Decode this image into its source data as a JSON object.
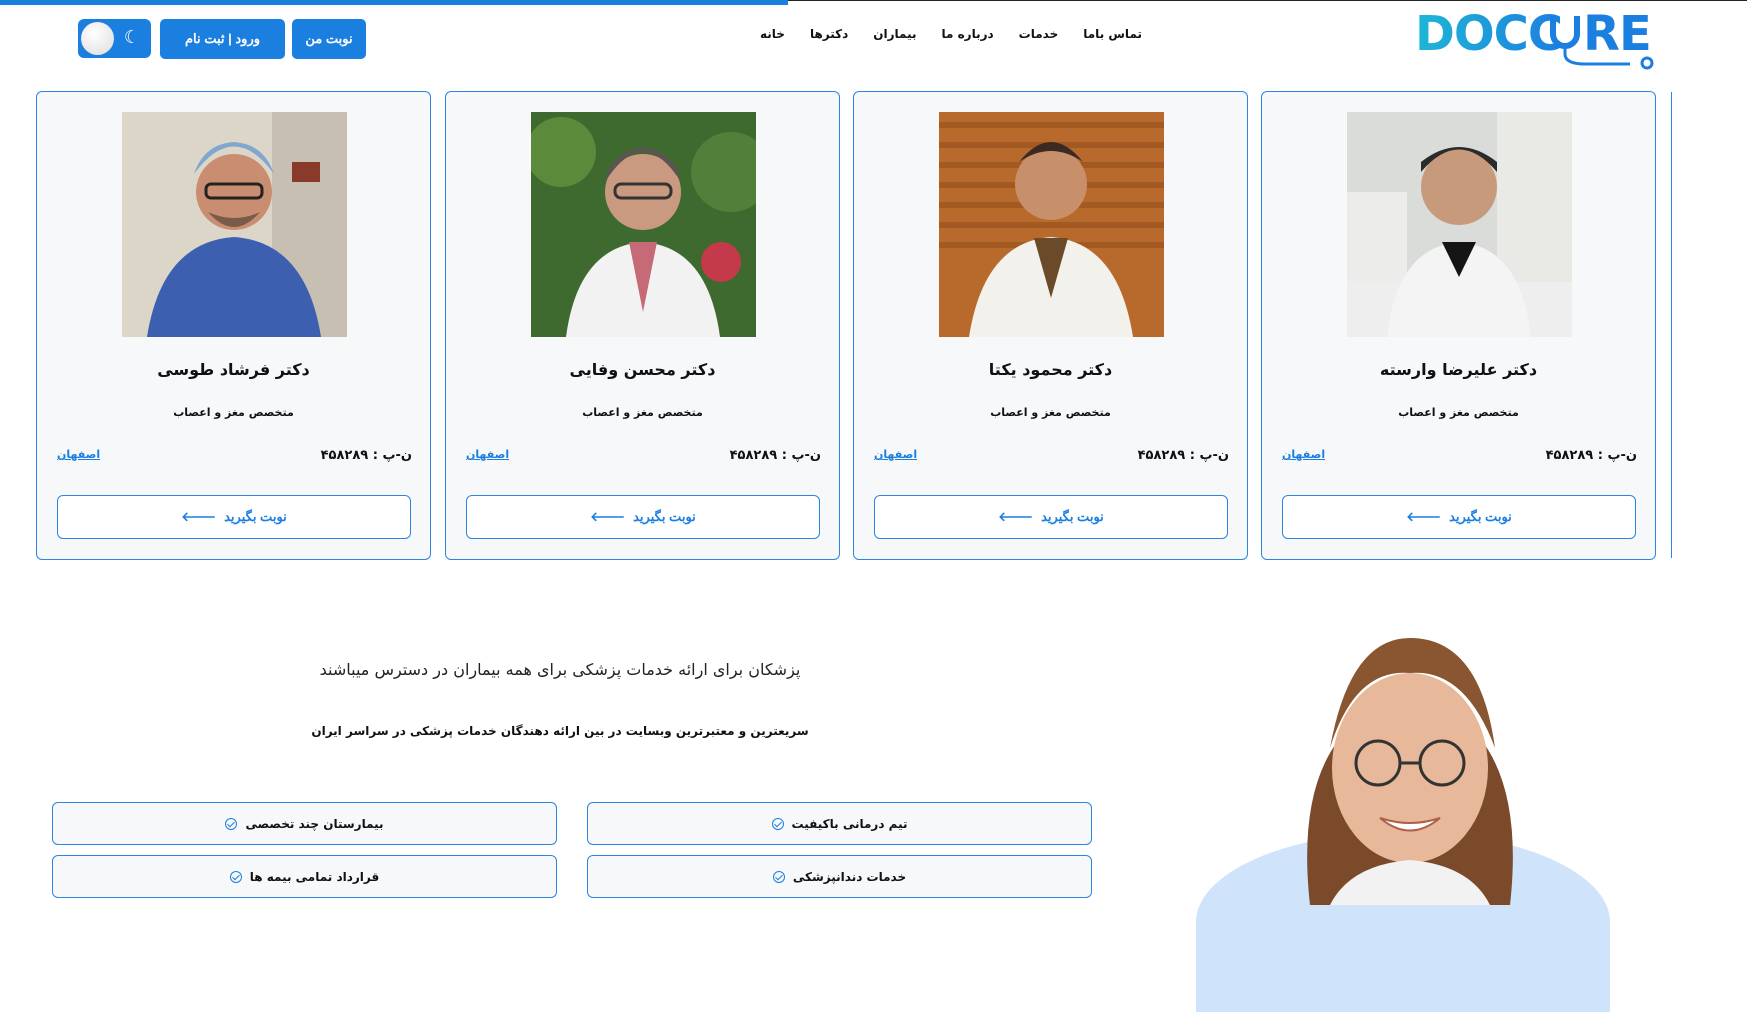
{
  "brand": {
    "name": "DOCCURE",
    "accent": "#1b7fe0"
  },
  "nav": {
    "items": [
      "خانه",
      "دکترها",
      "بیماران",
      "درباره ما",
      "خدمات",
      "تماس باما"
    ]
  },
  "header": {
    "appointment_label": "نوبت من",
    "login_label": "ورود | ثبت نام",
    "theme_toggle": "dark-mode-toggle"
  },
  "doctors": [
    {
      "name": "دکتر علیرضا وارسته",
      "specialty": "متخصص مغز و اعصاب",
      "code": "ن-پ : ۴۵۸۲۸۹",
      "city": "اصفهان",
      "book_label": "نوبت بگیرید"
    },
    {
      "name": "دکتر محمود یکتا",
      "specialty": "متخصص مغز و اعصاب",
      "code": "ن-پ : ۴۵۸۲۸۹",
      "city": "اصفهان",
      "book_label": "نوبت بگیرید"
    },
    {
      "name": "دکتر محسن وفایی",
      "specialty": "متخصص مغز و اعصاب",
      "code": "ن-پ : ۴۵۸۲۸۹",
      "city": "اصفهان",
      "book_label": "نوبت بگیرید"
    },
    {
      "name": "دکتر فرشاد طوسی",
      "specialty": "متخصص مغز و اعصاب",
      "code": "ن-پ : ۴۵۸۲۸۹",
      "city": "اصفهان",
      "book_label": "نوبت بگیرید"
    }
  ],
  "intro": {
    "title": "پزشکان برای ارائه خدمات پزشکی برای همه بیماران در دسترس میباشند",
    "subtitle": "سریعترین و معتبرترین وبسایت در بین ارائه دهندگان خدمات پزشکی در سراسر ایران"
  },
  "features": [
    "تیم درمانی باکیفیت",
    "بیمارستان چند تخصصی",
    "خدمات دندانپزشکی",
    "قرارداد تمامی بیمه ها"
  ]
}
